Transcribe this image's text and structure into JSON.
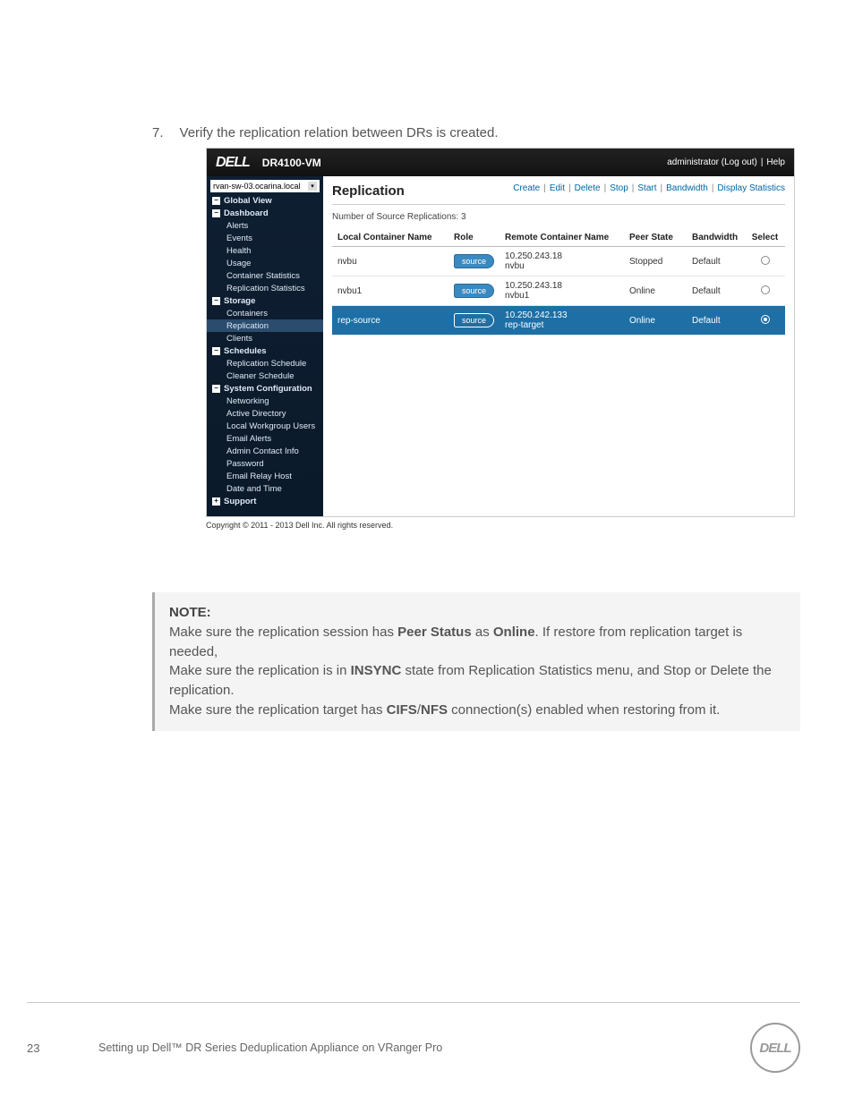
{
  "step": {
    "num": "7.",
    "text": "Verify the replication relation between DRs is created."
  },
  "topbar": {
    "logo": "DELL",
    "product": "DR4100-VM",
    "user": "administrator (Log out)",
    "help": "Help"
  },
  "sidebar": {
    "host": "rvan-sw-03.ocarina.local",
    "items": [
      {
        "expand": "minus",
        "bold": true,
        "label": "Global View"
      },
      {
        "expand": "minus",
        "bold": true,
        "label": "Dashboard"
      },
      {
        "child": true,
        "label": "Alerts"
      },
      {
        "child": true,
        "label": "Events"
      },
      {
        "child": true,
        "label": "Health"
      },
      {
        "child": true,
        "label": "Usage"
      },
      {
        "child": true,
        "label": "Container Statistics"
      },
      {
        "child": true,
        "label": "Replication Statistics"
      },
      {
        "expand": "minus",
        "bold": true,
        "label": "Storage"
      },
      {
        "child": true,
        "label": "Containers"
      },
      {
        "child": true,
        "active": true,
        "label": "Replication"
      },
      {
        "child": true,
        "label": "Clients"
      },
      {
        "expand": "minus",
        "bold": true,
        "label": "Schedules"
      },
      {
        "child": true,
        "label": "Replication Schedule"
      },
      {
        "child": true,
        "label": "Cleaner Schedule"
      },
      {
        "expand": "minus",
        "bold": true,
        "label": "System Configuration"
      },
      {
        "child": true,
        "label": "Networking"
      },
      {
        "child": true,
        "label": "Active Directory"
      },
      {
        "child": true,
        "label": "Local Workgroup Users"
      },
      {
        "child": true,
        "label": "Email Alerts"
      },
      {
        "child": true,
        "label": "Admin Contact Info"
      },
      {
        "child": true,
        "label": "Password"
      },
      {
        "child": true,
        "label": "Email Relay Host"
      },
      {
        "child": true,
        "label": "Date and Time"
      },
      {
        "expand": "plus",
        "bold": true,
        "label": "Support"
      }
    ]
  },
  "content": {
    "title": "Replication",
    "actions": [
      "Create",
      "Edit",
      "Delete",
      "Stop",
      "Start",
      "Bandwidth",
      "Display Statistics"
    ],
    "subline": "Number of Source Replications: 3",
    "headers": {
      "local": "Local Container Name",
      "role": "Role",
      "remote": "Remote Container Name",
      "peer": "Peer State",
      "bw": "Bandwidth",
      "sel": "Select"
    },
    "rows": [
      {
        "local": "nvbu",
        "role": "source",
        "remote_ip": "10.250.243.18",
        "remote_name": "nvbu",
        "peer": "Stopped",
        "bw": "Default",
        "selected": false,
        "hl": false
      },
      {
        "local": "nvbu1",
        "role": "source",
        "remote_ip": "10.250.243.18",
        "remote_name": "nvbu1",
        "peer": "Online",
        "bw": "Default",
        "selected": false,
        "hl": false
      },
      {
        "local": "rep-source",
        "role": "source",
        "remote_ip": "10.250.242.133",
        "remote_name": "rep-target",
        "peer": "Online",
        "bw": "Default",
        "selected": true,
        "hl": true
      }
    ]
  },
  "copyright": "Copyright © 2011 - 2013 Dell Inc. All rights reserved.",
  "note": {
    "title": "NOTE",
    "line1a": "Make sure the replication session has ",
    "line1b": "Peer Status",
    "line1c": " as ",
    "line1d": "Online",
    "line1e": ". If restore from replication target is needed,",
    "line2a": "Make sure the replication is in ",
    "line2b": "INSYNC",
    "line2c": " state from Replication Statistics menu, and Stop or Delete the replication.",
    "line3a": "Make sure the replication target has ",
    "line3b": "CIFS",
    "line3c": "/",
    "line3d": "NFS",
    "line3e": " connection(s) enabled when restoring from it."
  },
  "footer": {
    "page": "23",
    "title": "Setting up Dell™ DR Series Deduplication Appliance on VRanger Pro",
    "logo": "DELL"
  }
}
